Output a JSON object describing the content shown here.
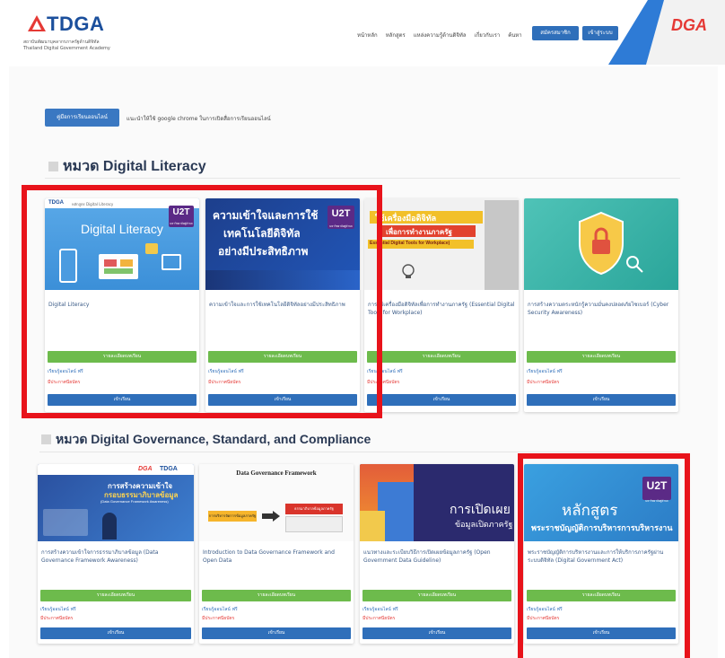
{
  "header": {
    "logo_text": "TDGA",
    "logo_sub_line1": "สถาบันพัฒนาบุคลากรภาครัฐด้านดิจิทัล",
    "logo_sub_line2": "Thailand Digital Government Academy",
    "nav": [
      "หน้าหลัก",
      "หลักสูตร",
      "แหล่งความรู้ด้านดิจิทัล",
      "เกี่ยวกับเรา",
      "ค้นหา"
    ],
    "register_label": "สมัครสมาชิก",
    "login_label": "เข้าสู่ระบบ",
    "dga_logo": "DGA"
  },
  "manual": {
    "button_label": "คู่มือการเรียนออนไลน์",
    "note": "แนะนำให้ใช้ google chrome ในการเปิดสื่อการเรียนออนไลน์"
  },
  "sections": [
    {
      "title": "หมวด Digital Literacy"
    },
    {
      "title": "หมวด Digital Governance, Standard, and Compliance"
    }
  ],
  "common": {
    "details_label": "รายละเอียดบทเรียน",
    "free_label": "เรียนรู้ออนไลน์ ฟรี",
    "cert_label": "มีประกาศนียบัตร",
    "enter_label": "เข้าเรียน"
  },
  "row1": [
    {
      "title": "Digital Literacy",
      "img_text": "Digital Literacy",
      "badge_brand": "TDGA",
      "badge_sub": "หลักสูตร Digital Literacy"
    },
    {
      "title": "ความเข้าใจและการใช้เทคโนโลยีดิจิทัลอย่างมีประสิทธิภาพ",
      "img_line1": "ความเข้าใจและการใช้",
      "img_line2": "เทคโนโลยีดิจิทัล",
      "img_line3": "อย่างมีประสิทธิภาพ"
    },
    {
      "title": "การใช้เครื่องมือดิจิทัลเพื่อการทำงานภาครัฐ (Essential Digital Tools for Workplace)",
      "img_line1": "ใช้เครื่องมือดิจิทัล",
      "img_line2": "เพื่อการทำงานภาครัฐ",
      "img_line3": "Essential Digital Tools for Workplace)"
    },
    {
      "title": "การสร้างความตระหนักรู้ความมั่นคงปลอดภัยไซเบอร์ (Cyber Security Awareness)"
    }
  ],
  "row2": [
    {
      "title": "การสร้างความเข้าใจการธรรมาภิบาลข้อมูล (Data Governance Framework Awareness)",
      "img_line1": "การสร้างความเข้าใจ",
      "img_line2": "กรอบธรรมาภิบาลข้อมูล",
      "img_line3": "(Data Governance Framework Awareness)",
      "img_brand1": "DGA",
      "img_brand2": "TDGA"
    },
    {
      "title": "Introduction to Data Governance Framework and Open Data",
      "img_heading": "Data Governance Framework",
      "img_box1": "การบริหารจัดการข้อมูลภาครัฐ",
      "img_box2": "ธรรมาภิบาลข้อมูลภาครัฐ"
    },
    {
      "title": "แนวทางและระเบียบวิธีการเปิดเผยข้อมูลภาครัฐ (Open Government Data Guideline)",
      "img_line1": "การเปิดเผย",
      "img_line2": "ข้อมูลเปิดภาครัฐ"
    },
    {
      "title": "พระราชบัญญัติการบริหารงานและการให้บริการภาครัฐผ่านระบบดิจิทัล (Digital Government Act)",
      "img_line1": "หลักสูตร",
      "img_line2": "พระราชบัญญัติการบริหารการบริหารงาน"
    }
  ],
  "u2t": {
    "main": "U2T",
    "sub": "มหาวิทยาลัยสู่ตำบล"
  },
  "colors": {
    "primary_blue": "#2f6fba",
    "green": "#6dbb4c",
    "highlight_red": "#e8131b",
    "cert_red": "#e53935"
  }
}
